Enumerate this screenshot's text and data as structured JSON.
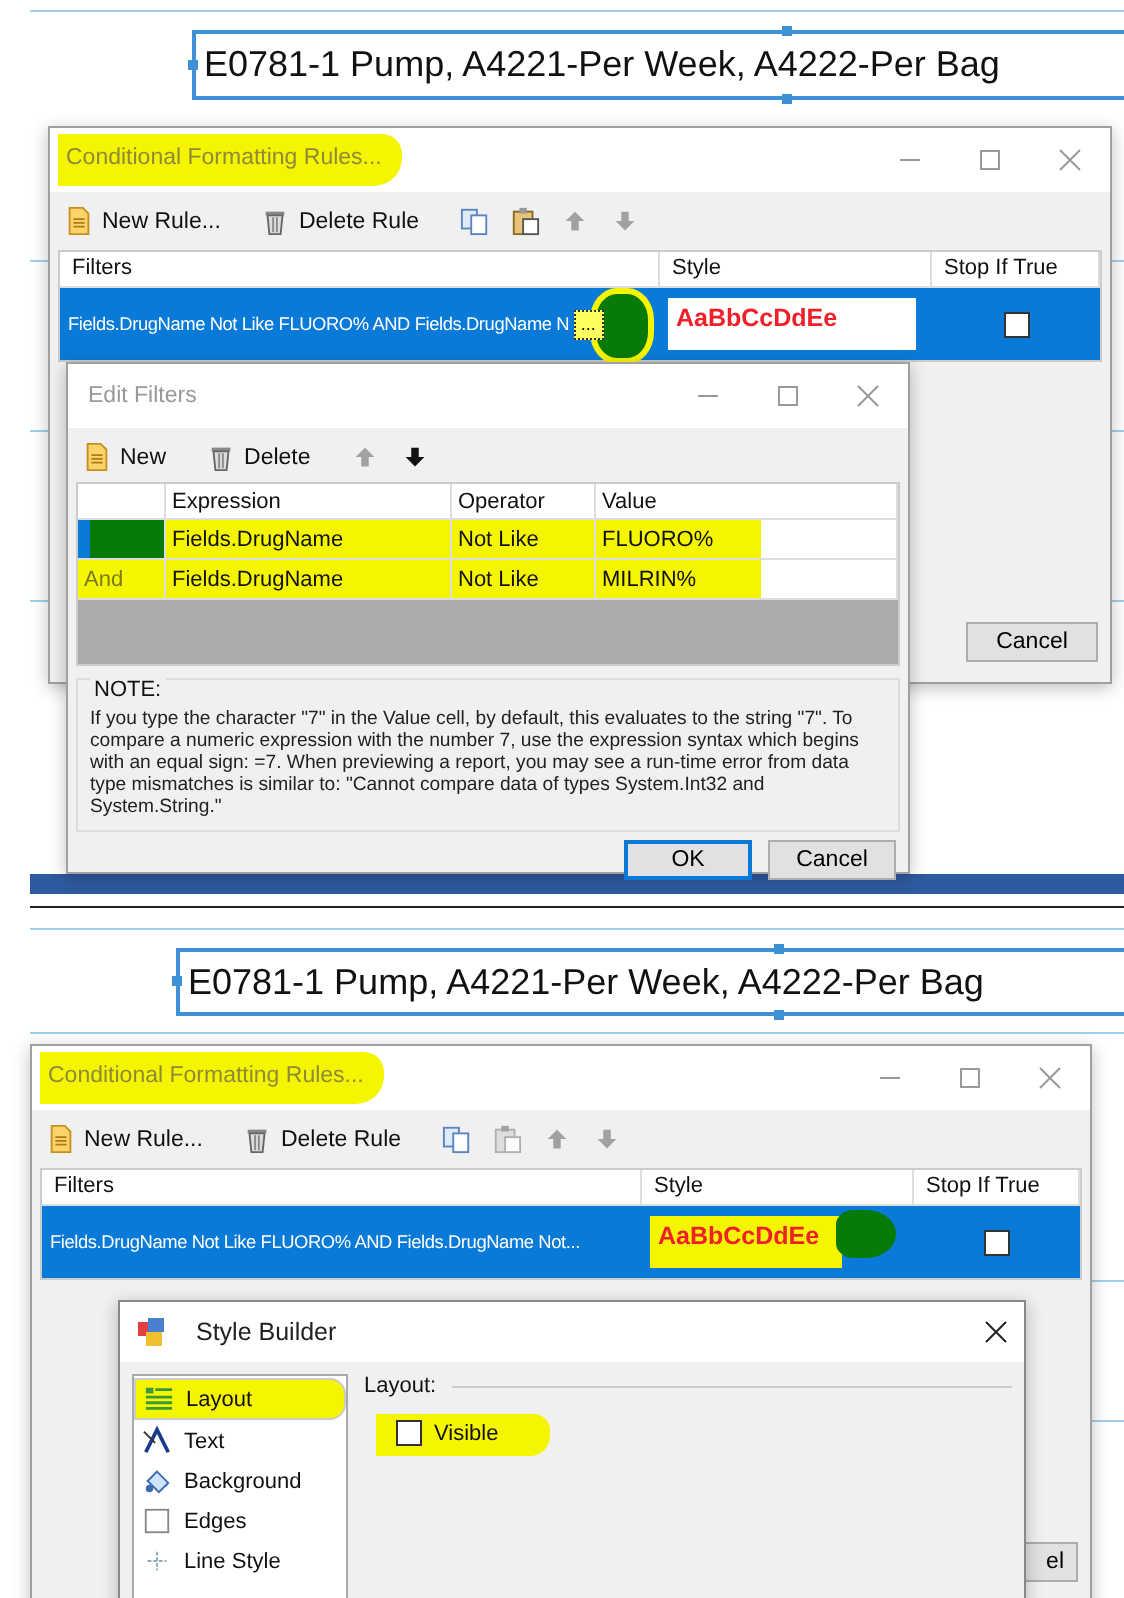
{
  "screens": [
    {
      "report_title": "E0781-1 Pump, A4221-Per Week, A4222-Per Bag",
      "rules_window": {
        "title": "Conditional Formatting Rules...",
        "title_highlighted": true,
        "toolbar": [
          {
            "kind": "new",
            "label": "New Rule...",
            "disabled": false
          },
          {
            "kind": "delete",
            "label": "Delete Rule",
            "disabled": false
          },
          {
            "kind": "copy",
            "disabled": false
          },
          {
            "kind": "paste",
            "disabled": false
          },
          {
            "kind": "up",
            "disabled": true
          },
          {
            "kind": "down",
            "disabled": true
          }
        ],
        "columns": [
          "Filters",
          "Style",
          "Stop If True"
        ],
        "rows": [
          {
            "filter": "Fields.DrugName Not Like FLUORO% AND Fields.DrugName N",
            "edit_button": "...",
            "style_sample": "AaBbCcDdEe",
            "style_highlighted": false,
            "stop_if_true": false,
            "selected": true
          }
        ],
        "footer_buttons": [
          "Cancel"
        ]
      },
      "edit_filters": {
        "title": "Edit Filters",
        "toolbar": [
          {
            "kind": "new",
            "label": "New",
            "disabled": false
          },
          {
            "kind": "delete",
            "label": "Delete",
            "disabled": false
          },
          {
            "kind": "up",
            "disabled": true
          },
          {
            "kind": "down",
            "disabled": false
          }
        ],
        "columns": [
          "Expression",
          "Operator",
          "Value"
        ],
        "rows": [
          {
            "expression": "Fields.DrugName",
            "operator": "Not Like",
            "value": "FLUORO%",
            "selected": true,
            "highlighted": true
          },
          {
            "conjunction": "And",
            "expression": "Fields.DrugName",
            "operator": "Not Like",
            "value": "MILRIN%",
            "selected": false,
            "highlighted": true
          }
        ],
        "note_title": "NOTE:",
        "note": "If you type the character \"7\" in the Value cell, by default, this evaluates to the string \"7\". To compare a numeric expression with the number 7, use the expression syntax which begins with an equal sign: =7. When previewing a report, you may see a run-time error from data type mismatches is similar to: \"Cannot compare data of types System.Int32 and System.String.\"",
        "buttons": [
          {
            "label": "OK",
            "default": true
          },
          {
            "label": "Cancel",
            "default": false
          }
        ]
      }
    },
    {
      "report_title": "E0781-1 Pump, A4221-Per Week, A4222-Per Bag",
      "rules_window": {
        "title": "Conditional Formatting Rules...",
        "title_highlighted": true,
        "toolbar": [
          {
            "kind": "new",
            "label": "New Rule...",
            "disabled": false
          },
          {
            "kind": "delete",
            "label": "Delete Rule",
            "disabled": false
          },
          {
            "kind": "copy",
            "disabled": false
          },
          {
            "kind": "paste",
            "disabled": true
          },
          {
            "kind": "up",
            "disabled": true
          },
          {
            "kind": "down",
            "disabled": true
          }
        ],
        "columns": [
          "Filters",
          "Style",
          "Stop If True"
        ],
        "rows": [
          {
            "filter": "Fields.DrugName Not Like FLUORO% AND Fields.DrugName Not...",
            "style_sample": "AaBbCcDdEe",
            "style_highlighted": true,
            "stop_if_true": false,
            "selected": true
          }
        ],
        "footer_buttons": [
          "el"
        ]
      },
      "style_builder": {
        "title": "Style Builder",
        "categories": [
          {
            "kind": "layout",
            "label": "Layout",
            "selected": true,
            "highlighted": true
          },
          {
            "kind": "text",
            "label": "Text",
            "selected": false,
            "highlighted": false
          },
          {
            "kind": "background",
            "label": "Background",
            "selected": false,
            "highlighted": false
          },
          {
            "kind": "edges",
            "label": "Edges",
            "selected": false,
            "highlighted": false
          },
          {
            "kind": "line",
            "label": "Line Style",
            "selected": false,
            "highlighted": false
          }
        ],
        "section": "Layout:",
        "visible": {
          "label": "Visible",
          "checked": false,
          "highlighted": true
        }
      }
    }
  ]
}
